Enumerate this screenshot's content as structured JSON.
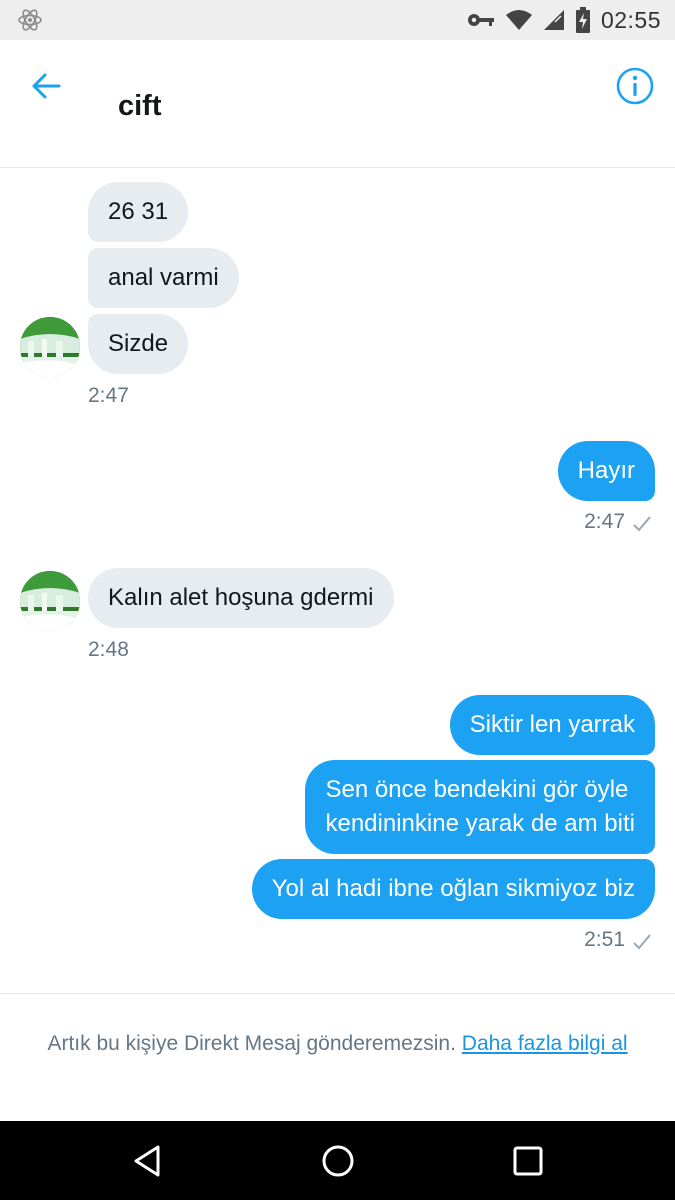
{
  "status_bar": {
    "time": "02:55",
    "icons": [
      "react-atom-icon",
      "key-icon",
      "wifi-icon",
      "signal-icon",
      "battery-icon"
    ]
  },
  "header": {
    "title": "cift",
    "back_icon": "back-arrow-icon",
    "info_icon": "info-icon"
  },
  "messages": {
    "group1": {
      "lines": [
        "26  31",
        "anal varmi",
        "Sizde"
      ],
      "time": "2:47"
    },
    "group2": {
      "lines": [
        "Hayır"
      ],
      "time": "2:47"
    },
    "group3": {
      "lines": [
        "Kalın alet hoşuna gdermi"
      ],
      "time": "2:48"
    },
    "group4": {
      "line1": "Siktir len yarrak",
      "line2a": "Sen önce bendekini gör öyle",
      "line2b": "kendininkine yarak de am biti",
      "line3": "Yol al hadi ibne oğlan sikmiyoz biz",
      "time": "2:51"
    }
  },
  "footer": {
    "notice": "Artık bu kişiye Direkt Mesaj gönderemezsin.",
    "link": "Daha fazla bilgi al"
  },
  "colors": {
    "accent": "#1da1f2",
    "incoming_bubble": "#e6ecf0",
    "timestamp": "#657786"
  }
}
